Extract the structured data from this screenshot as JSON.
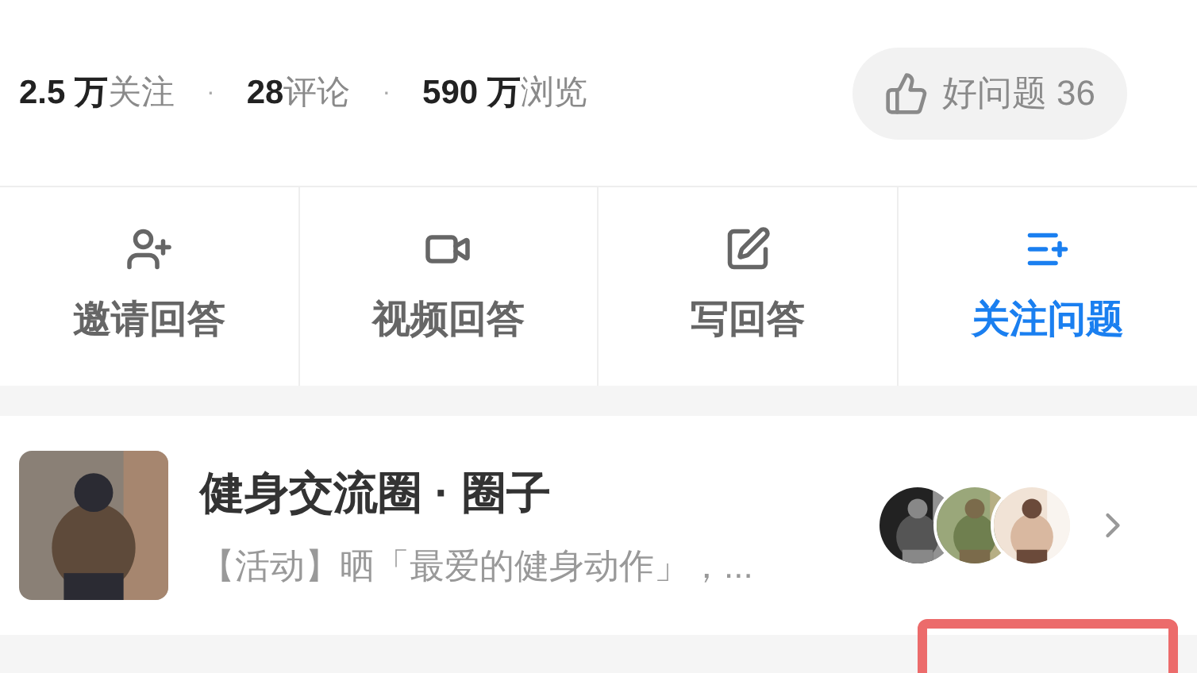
{
  "stats": [
    {
      "value": "2.5 万",
      "label": "关注"
    },
    {
      "value": "28",
      "label": "评论"
    },
    {
      "value": "590 万",
      "label": "浏览"
    }
  ],
  "separator": "·",
  "good_question_button": {
    "label": "好问题 36"
  },
  "actions": [
    {
      "kind": "invite",
      "label": "邀请回答",
      "selected": false
    },
    {
      "kind": "video",
      "label": "视频回答",
      "selected": false
    },
    {
      "kind": "write",
      "label": "写回答",
      "selected": false
    },
    {
      "kind": "follow",
      "label": "关注问题",
      "selected": true
    }
  ],
  "circle": {
    "title": "健身交流圈 · 圈子",
    "subtitle": "【活动】晒「最爱的健身动作」，..."
  }
}
